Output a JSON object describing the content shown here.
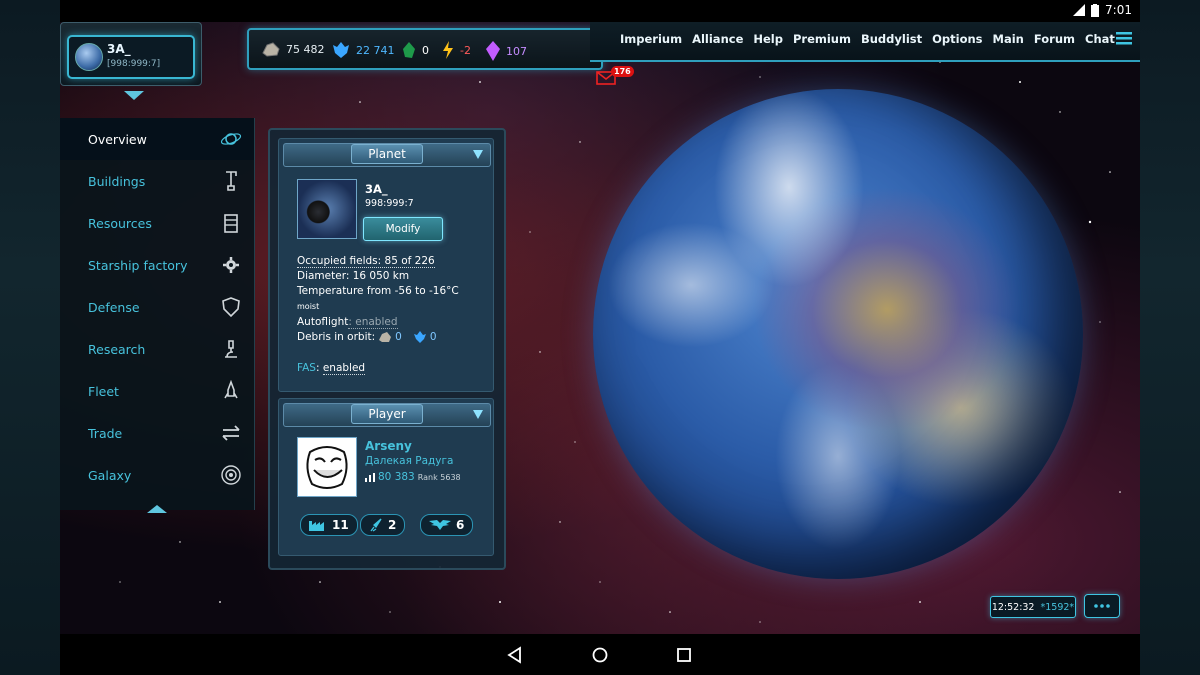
{
  "statusbar": {
    "time": "7:01"
  },
  "player": {
    "name": "3A_",
    "coords": "[998:999:7]"
  },
  "resources": [
    {
      "icon": "ore-icon",
      "value": "75 482",
      "color": "#e6eef2"
    },
    {
      "icon": "crystal-icon",
      "value": "22 741",
      "color": "#4fb8ff"
    },
    {
      "icon": "deuterium-icon",
      "value": "0",
      "color": "#e6eef2"
    },
    {
      "icon": "energy-icon",
      "value": "-2",
      "color": "#ff5a5a"
    },
    {
      "icon": "darkmatter-icon",
      "value": "107",
      "color": "#c58cff"
    }
  ],
  "nav": [
    "Imperium",
    "Alliance",
    "Help",
    "Premium",
    "Buddylist",
    "Options",
    "Main",
    "Forum",
    "Chat"
  ],
  "mail": {
    "count": "176"
  },
  "sidebar": {
    "items": [
      {
        "label": "Overview",
        "icon": "orbit-icon",
        "active": true
      },
      {
        "label": "Buildings",
        "icon": "crane-icon"
      },
      {
        "label": "Resources",
        "icon": "mine-icon"
      },
      {
        "label": "Starship factory",
        "icon": "gear-icon"
      },
      {
        "label": "Defense",
        "icon": "shield-icon"
      },
      {
        "label": "Research",
        "icon": "microscope-icon"
      },
      {
        "label": "Fleet",
        "icon": "rocket-icon"
      },
      {
        "label": "Trade",
        "icon": "exchange-icon"
      },
      {
        "label": "Galaxy",
        "icon": "galaxy-icon"
      }
    ]
  },
  "planet_panel": {
    "title": "Planet",
    "name": "3A_",
    "coords": "998:999:7",
    "modify_label": "Modify",
    "occupied": "Occupied fields: 85 of 226",
    "diameter": "Diameter: 16 050 km",
    "temperature": "Temperature from -56 to -16°C",
    "climate": "moist",
    "autoflight_label": "Autoflight",
    "autoflight_value": ": enabled",
    "debris_label": "Debris in orbit:",
    "debris_ore": "0",
    "debris_crystal": "0",
    "fas_label": "FAS",
    "fas_value": "enabled"
  },
  "player_panel": {
    "title": "Player",
    "name": "Arseny",
    "alliance": "Далекая Радуга",
    "points": "80 383",
    "rank": "Rank 5638",
    "stats": [
      {
        "icon": "factory-icon",
        "value": "11"
      },
      {
        "icon": "rocket-icon",
        "value": "2"
      },
      {
        "icon": "wings-icon",
        "value": "6"
      }
    ]
  },
  "clock": {
    "time": "12:52:32",
    "server": "*1592*"
  }
}
